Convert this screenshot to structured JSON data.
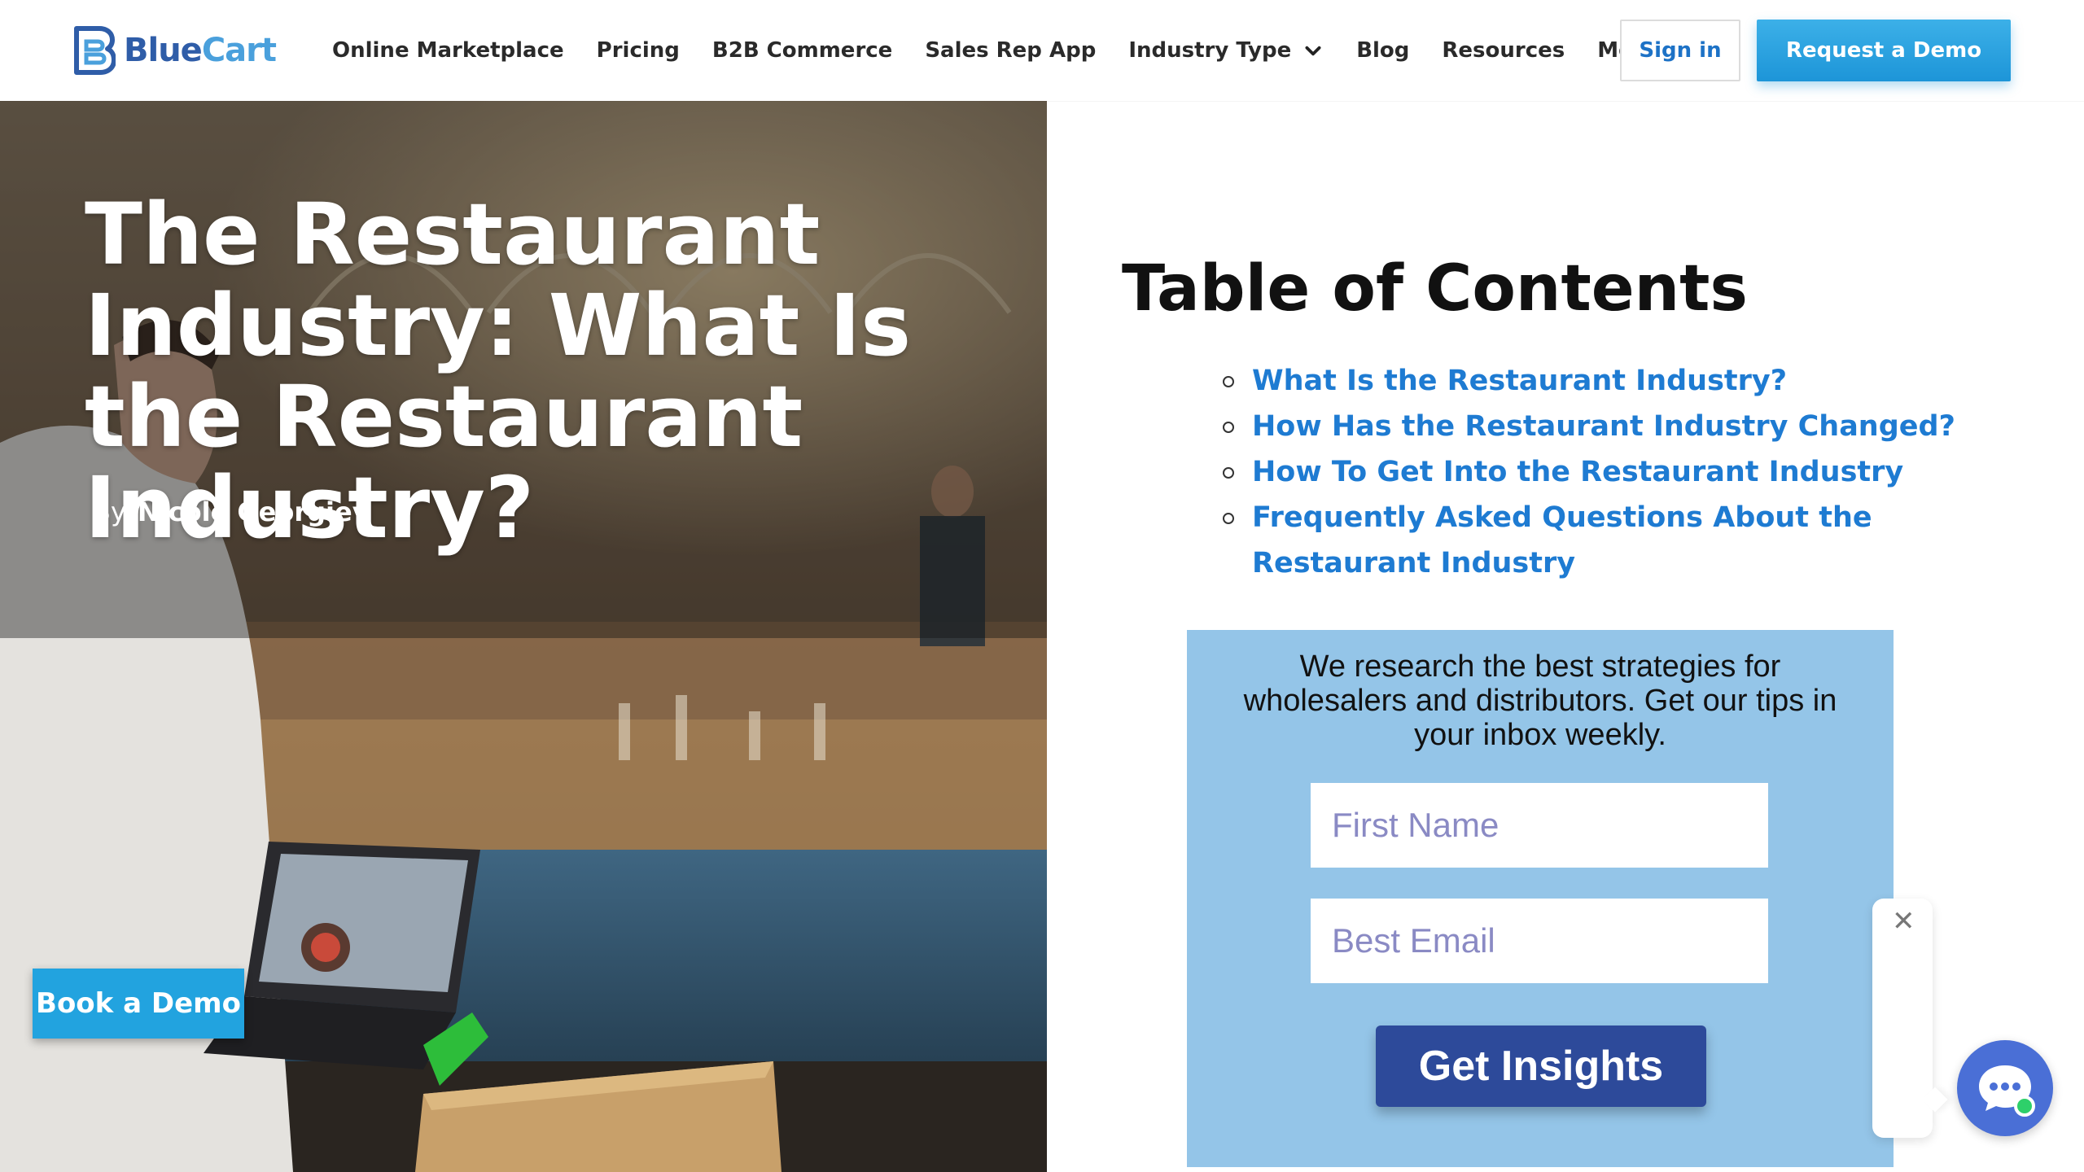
{
  "brand": {
    "name_part1": "Blue",
    "name_part2": "Cart",
    "logo_icon": "bluecart-logo-icon",
    "colors": {
      "primary": "#2f5da8",
      "accent": "#4aa0dc"
    }
  },
  "nav": {
    "items": [
      {
        "label": "Online Marketplace",
        "has_dropdown": false
      },
      {
        "label": "Pricing",
        "has_dropdown": false
      },
      {
        "label": "B2B Commerce",
        "has_dropdown": false
      },
      {
        "label": "Sales Rep App",
        "has_dropdown": false
      },
      {
        "label": "Industry Type",
        "has_dropdown": true
      },
      {
        "label": "Blog",
        "has_dropdown": false
      },
      {
        "label": "Resources",
        "has_dropdown": false
      },
      {
        "label": "More",
        "has_dropdown": true
      }
    ],
    "sign_in_label": "Sign in",
    "request_demo_label": "Request a Demo"
  },
  "hero": {
    "title": "The Restaurant Industry: What Is the Restaurant Industry?",
    "byline_prefix": "By",
    "author": "Nicole Georgiev",
    "book_demo_label": "Book a Demo"
  },
  "toc": {
    "title": "Table of Contents",
    "items": [
      "What Is the Restaurant Industry?",
      "How Has the Restaurant Industry Changed?",
      "How To Get Into the Restaurant Industry",
      "Frequently Asked Questions About the Restaurant Industry"
    ]
  },
  "newsletter": {
    "text": "We research the best strategies for wholesalers and distributors. Get our tips in your inbox weekly.",
    "first_name_placeholder": "First Name",
    "email_placeholder": "Best Email",
    "button_label": "Get Insights",
    "background_color": "#94c5e8",
    "button_color": "#2d4a9a"
  },
  "chat": {
    "close_symbol": "✕",
    "icon": "chat-bubble-icon",
    "status_color": "#2ed06a"
  }
}
